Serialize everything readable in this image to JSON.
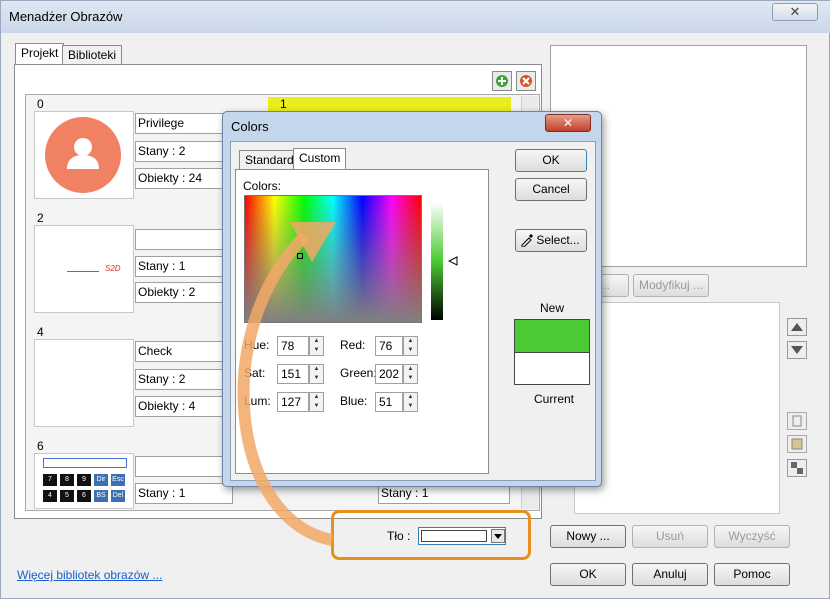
{
  "window": {
    "title": "Menadżer Obrazów",
    "close": "✕"
  },
  "tabs": [
    "Projekt",
    "Biblioteki"
  ],
  "images": [
    {
      "index": "0",
      "name": "Privilege",
      "states": "Stany : 2",
      "objects": "Obiekty : 24"
    },
    {
      "index": "2",
      "name": "",
      "states": "Stany : 1",
      "objects": "Obiekty : 2",
      "preview_text": "S2D"
    },
    {
      "index": "4",
      "name": "Check",
      "states": "Stany : 2",
      "objects": "Obiekty : 4"
    },
    {
      "index": "6",
      "name": "",
      "states": "Stany : 1",
      "objects": ""
    }
  ],
  "images_right": [
    {
      "index": "1"
    },
    {
      "index": "",
      "states": "Stany : 1"
    }
  ],
  "calculator_keys": [
    "7",
    "8",
    "9",
    "Dir",
    "Esc",
    "4",
    "5",
    "6",
    "BS",
    "Del"
  ],
  "edit_buttons": {
    "partial": "...",
    "modify": "Modyfikuj ..."
  },
  "tlo": {
    "label": "Tło :"
  },
  "bottom_buttons": {
    "new": "Nowy ...",
    "delete": "Usuń",
    "clear": "Wyczyść"
  },
  "link": "Więcej bibliotek obrazów ...",
  "dialog_buttons": {
    "ok": "OK",
    "cancel": "Anuluj",
    "help": "Pomoc"
  },
  "colors_dialog": {
    "title": "Colors",
    "tabs": [
      "Standard",
      "Custom"
    ],
    "colors_label": "Colors:",
    "ok": "OK",
    "cancel": "Cancel",
    "select": "Select...",
    "new_label": "New",
    "current_label": "Current",
    "hue_label": "Hue:",
    "hue": "78",
    "sat_label": "Sat:",
    "sat": "151",
    "lum_label": "Lum:",
    "lum": "127",
    "red_label": "Red:",
    "red": "76",
    "green_label": "Green:",
    "green": "202",
    "blue_label": "Blue:",
    "blue": "51",
    "new_color": "#4cca33",
    "current_color": "#ffffff"
  },
  "colors": {
    "highlight": "#e8901f",
    "accent_bar": "#e9ee1c",
    "avatar": "#f08263"
  }
}
